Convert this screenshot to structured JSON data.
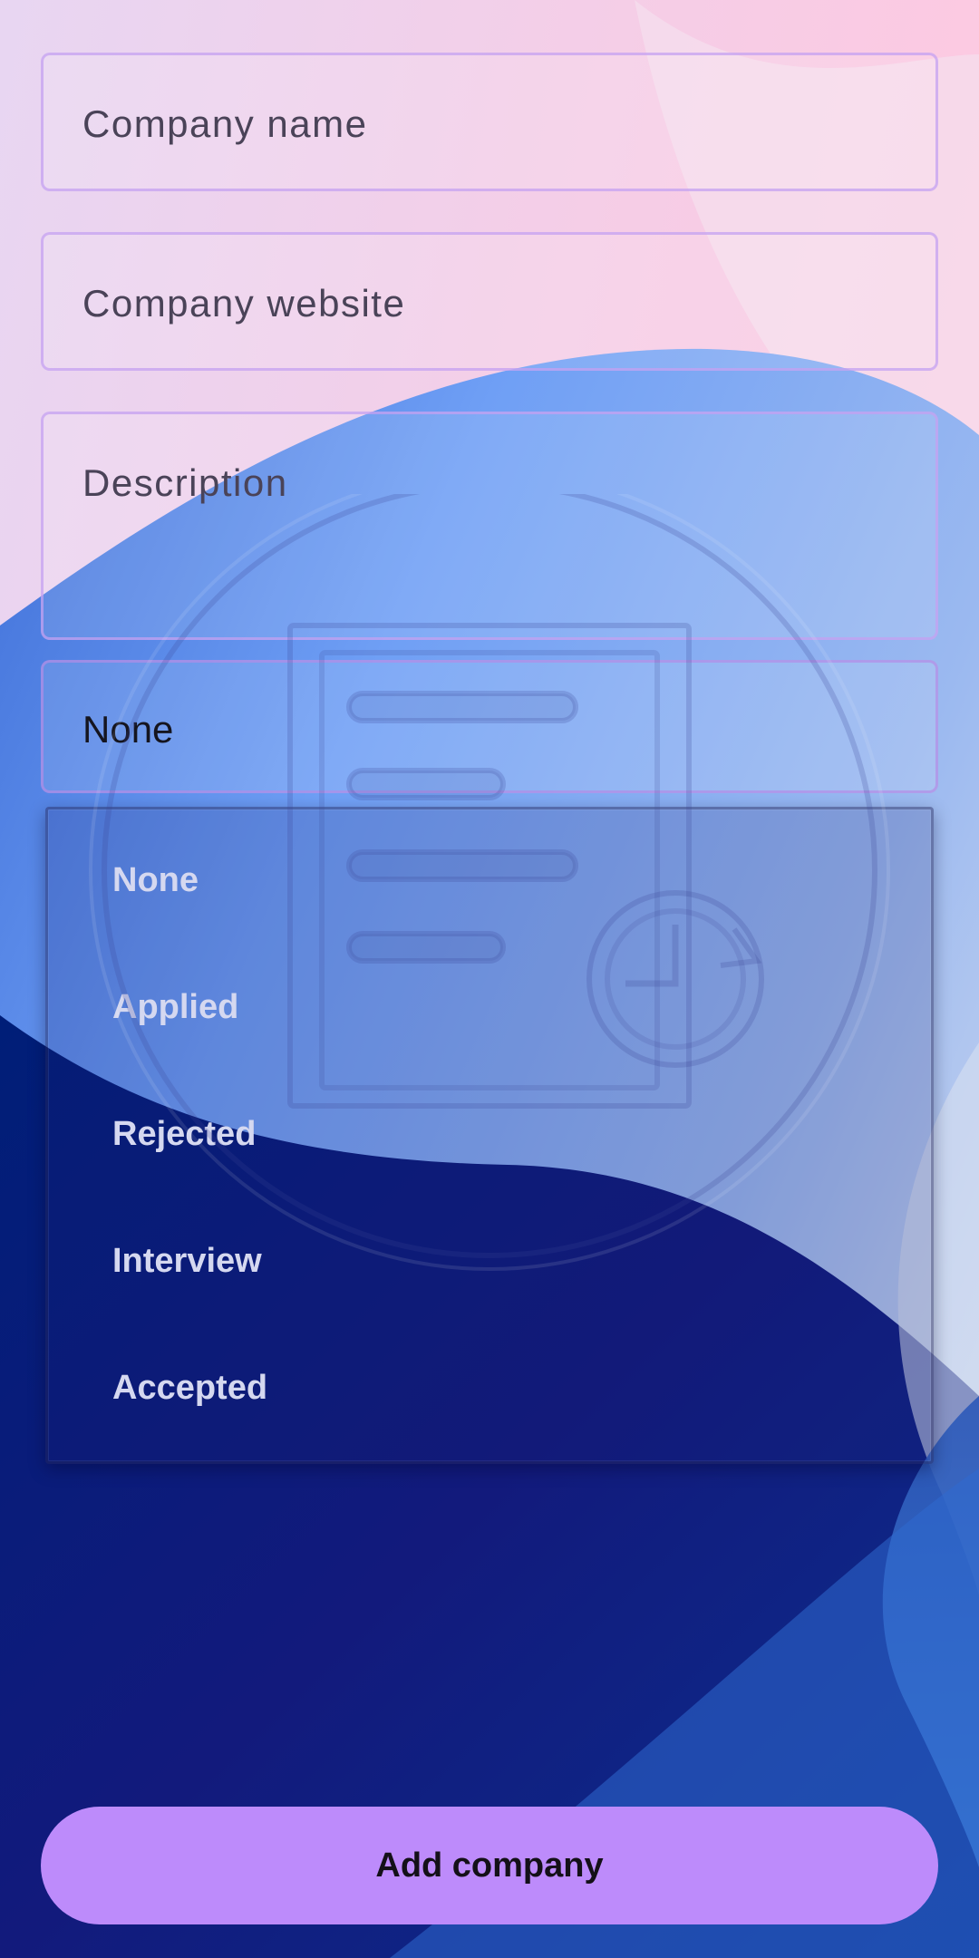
{
  "form": {
    "company_name_placeholder": "Company name",
    "company_website_placeholder": "Company website",
    "description_placeholder": "Description",
    "status_value": "None"
  },
  "status_menu": {
    "options": [
      "None",
      "Applied",
      "Rejected",
      "Interview",
      "Accepted"
    ]
  },
  "actions": {
    "add_label": "Add company"
  },
  "icons": {
    "watermark": "job-application-status-icon"
  },
  "colors": {
    "button": "#bd8bfb",
    "field_border": "#c4a0f0",
    "menu_text": "#d5d8f0",
    "bg_pink": "#f7c6e0",
    "bg_blue": "#6d9af5",
    "bg_navy": "#0a1f7a"
  }
}
